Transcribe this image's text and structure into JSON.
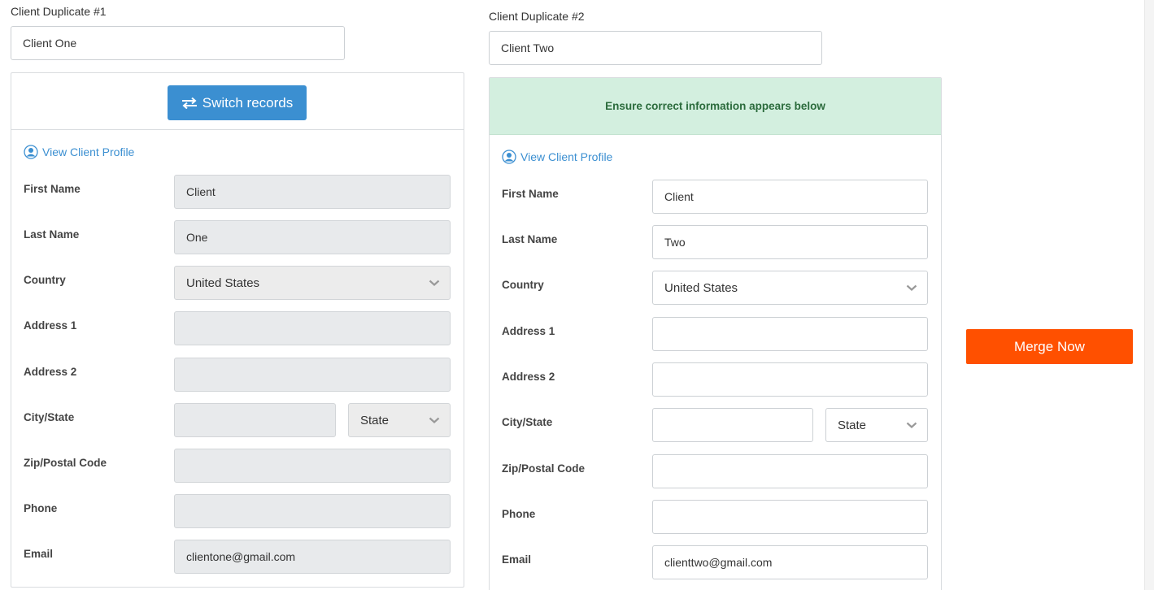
{
  "left": {
    "label": "Client Duplicate #1",
    "search_value": "Client One",
    "switch_label": "Switch records",
    "profile_link": "View Client Profile",
    "fields": {
      "first_name": {
        "label": "First Name",
        "value": "Client"
      },
      "last_name": {
        "label": "Last Name",
        "value": "One"
      },
      "country": {
        "label": "Country",
        "value": "United States"
      },
      "address1": {
        "label": "Address 1",
        "value": ""
      },
      "address2": {
        "label": "Address 2",
        "value": ""
      },
      "city_state": {
        "label": "City/State",
        "city": "",
        "state": "State"
      },
      "zip": {
        "label": "Zip/Postal Code",
        "value": ""
      },
      "phone": {
        "label": "Phone",
        "value": ""
      },
      "email": {
        "label": "Email",
        "value": "clientone@gmail.com"
      }
    }
  },
  "right": {
    "label": "Client Duplicate #2",
    "search_value": "Client Two",
    "notice": "Ensure correct information appears below",
    "profile_link": "View Client Profile",
    "fields": {
      "first_name": {
        "label": "First Name",
        "value": "Client"
      },
      "last_name": {
        "label": "Last Name",
        "value": "Two"
      },
      "country": {
        "label": "Country",
        "value": "United States"
      },
      "address1": {
        "label": "Address 1",
        "value": ""
      },
      "address2": {
        "label": "Address 2",
        "value": ""
      },
      "city_state": {
        "label": "City/State",
        "city": "",
        "state": "State"
      },
      "zip": {
        "label": "Zip/Postal Code",
        "value": ""
      },
      "phone": {
        "label": "Phone",
        "value": ""
      },
      "email": {
        "label": "Email",
        "value": "clienttwo@gmail.com"
      }
    }
  },
  "actions": {
    "merge_label": "Merge Now"
  },
  "colors": {
    "primary": "#3b8fd1",
    "merge": "#ff5000",
    "notice_bg": "#d3efdf",
    "notice_text": "#2b6b3c"
  },
  "icons": {
    "switch": "swap-arrows-icon",
    "profile": "user-circle-icon",
    "chevron": "chevron-down-icon"
  }
}
